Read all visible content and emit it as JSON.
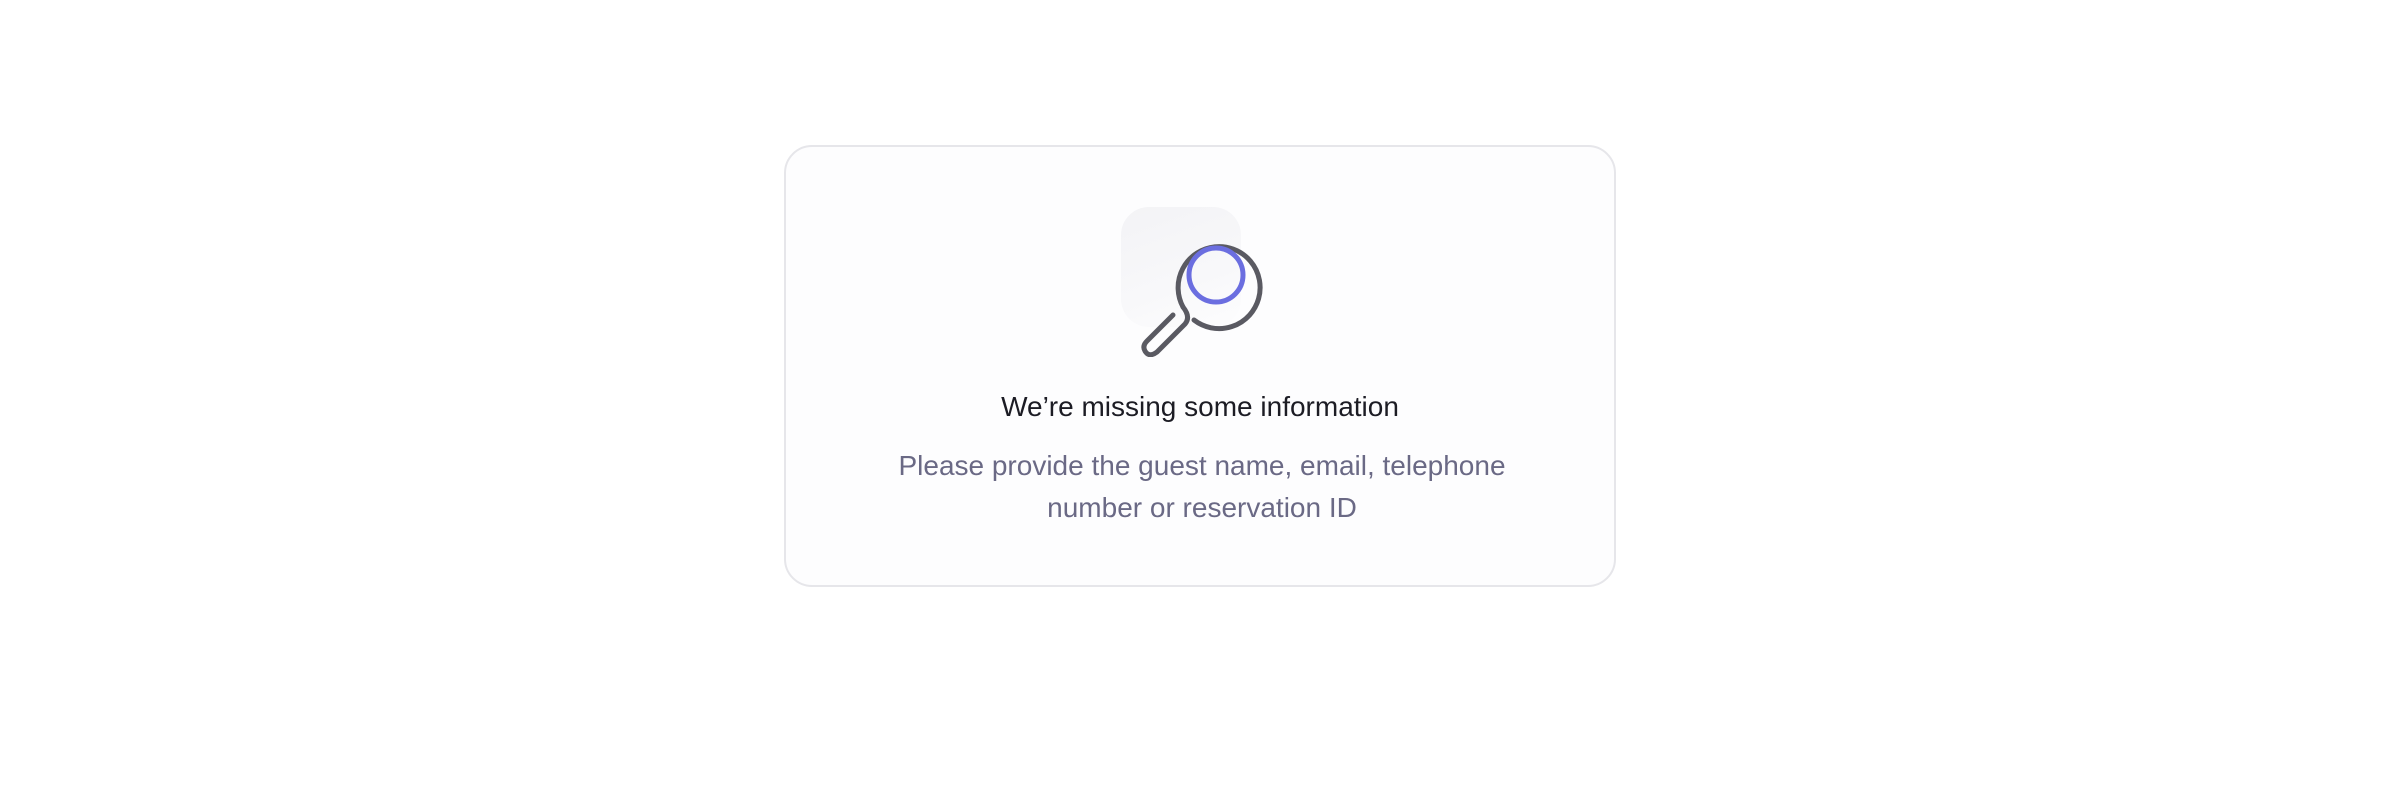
{
  "empty_state": {
    "icon": "magnifying-glass-icon",
    "title": "We’re missing some information",
    "message": "Please provide the guest name, email, telephone number or reservation ID"
  },
  "colors": {
    "card_border": "#e6e6ea",
    "icon_stroke": "#5a5a62",
    "icon_accent": "#6b6ee0",
    "title_text": "#1c1c24",
    "message_text": "#6a6985"
  }
}
